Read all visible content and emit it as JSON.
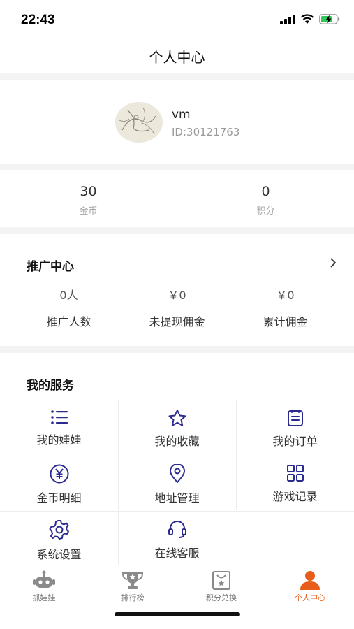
{
  "status_bar": {
    "time": "22:43"
  },
  "nav": {
    "title": "个人中心"
  },
  "profile": {
    "username": "vm",
    "user_id": "ID:30121763"
  },
  "assets": [
    {
      "value": "30",
      "label": "金币"
    },
    {
      "value": "0",
      "label": "积分"
    }
  ],
  "promo": {
    "title": "推广中心",
    "stats": [
      {
        "value": "0人",
        "label": "推广人数"
      },
      {
        "value": "￥0",
        "label": "未提现佣金"
      },
      {
        "value": "￥0",
        "label": "累计佣金"
      }
    ]
  },
  "services": {
    "title": "我的服务",
    "items": [
      {
        "label": "我的娃娃",
        "icon": "list-icon"
      },
      {
        "label": "我的收藏",
        "icon": "star-icon"
      },
      {
        "label": "我的订单",
        "icon": "order-icon"
      },
      {
        "label": "金币明细",
        "icon": "yen-coin-icon"
      },
      {
        "label": "地址管理",
        "icon": "location-pin-icon"
      },
      {
        "label": "游戏记录",
        "icon": "grid-icon"
      },
      {
        "label": "系统设置",
        "icon": "gear-icon"
      },
      {
        "label": "在线客服",
        "icon": "headset-icon"
      }
    ]
  },
  "tabs": [
    {
      "label": "抓娃娃",
      "icon": "robot-icon",
      "active": false
    },
    {
      "label": "排行榜",
      "icon": "trophy-icon",
      "active": false
    },
    {
      "label": "积分兑换",
      "icon": "exchange-bag-icon",
      "active": false
    },
    {
      "label": "个人中心",
      "icon": "person-icon",
      "active": true
    }
  ],
  "colors": {
    "accent_icon": "#2b2b8f",
    "active_tab": "#e85d1b",
    "inactive_tab": "#777777"
  }
}
